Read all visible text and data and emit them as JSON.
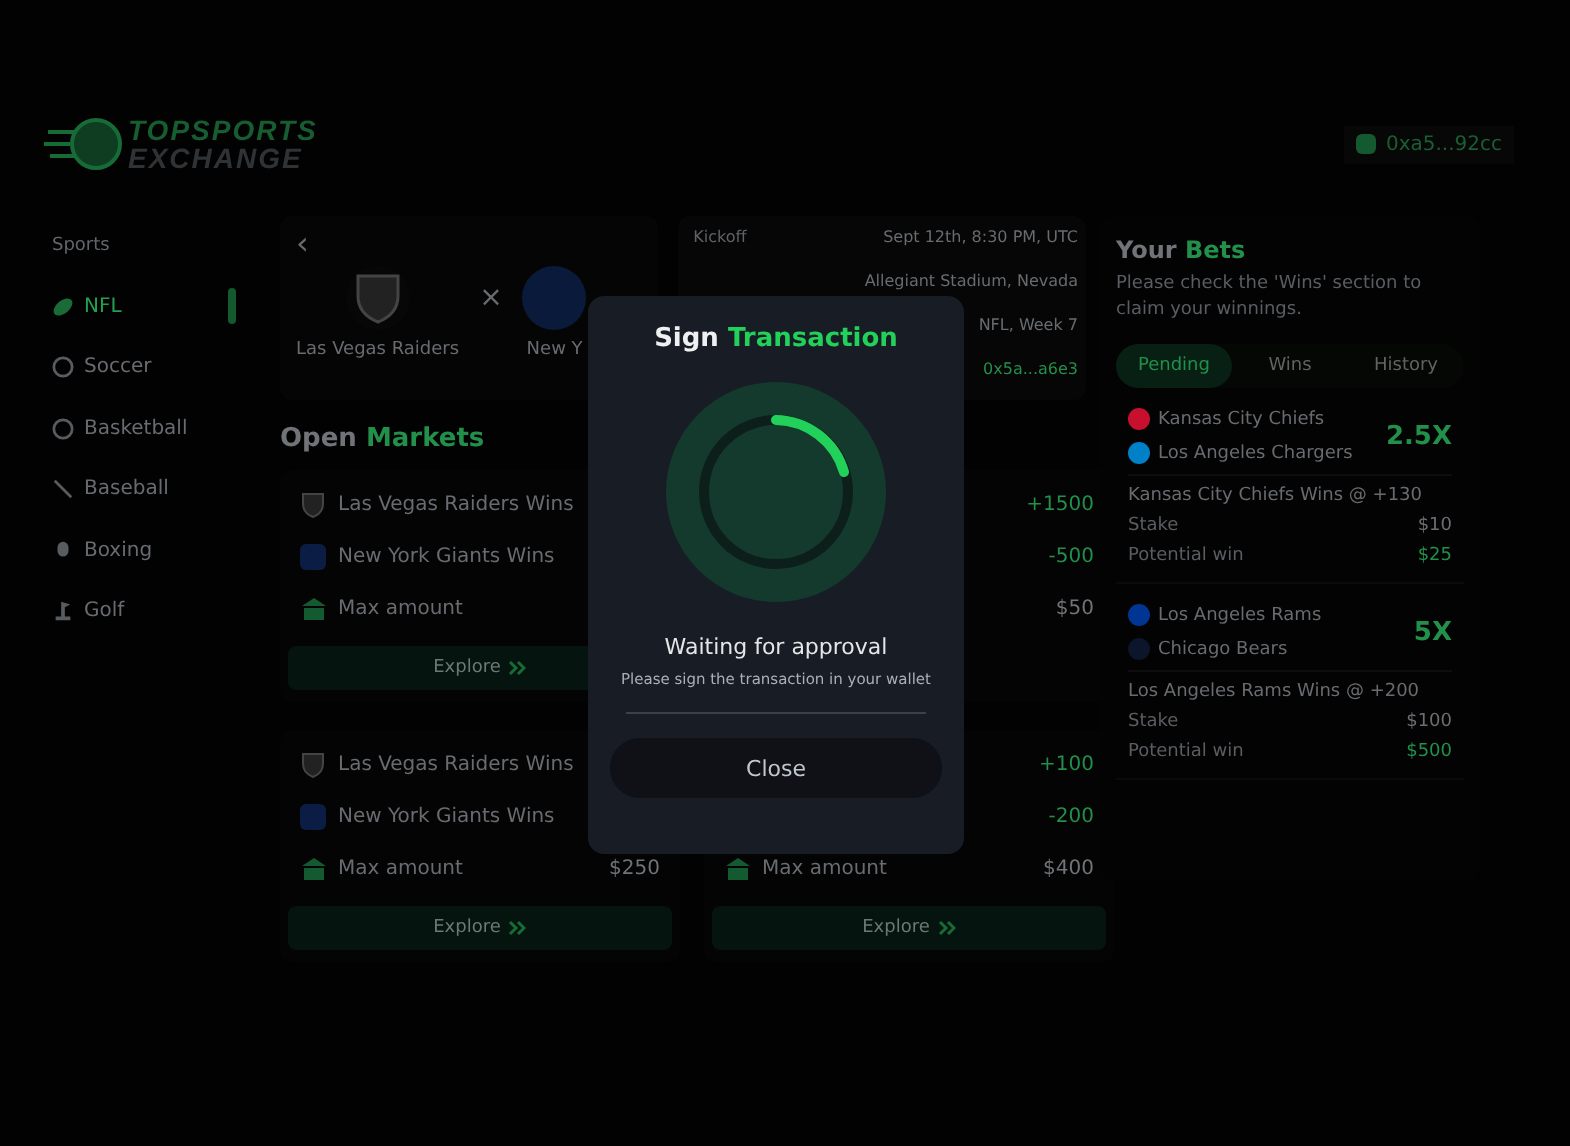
{
  "brand": {
    "line1": "TOPSPORTS",
    "line2": "EXCHANGE"
  },
  "wallet": {
    "address": "0xa5...92cc"
  },
  "sidebar": {
    "heading": "Sports",
    "items": [
      {
        "label": "NFL",
        "kind": "football",
        "selected": true
      },
      {
        "label": "Soccer",
        "kind": "soccer",
        "selected": false
      },
      {
        "label": "Basketball",
        "kind": "basketball",
        "selected": false
      },
      {
        "label": "Baseball",
        "kind": "baseball",
        "selected": false
      },
      {
        "label": "Boxing",
        "kind": "boxing",
        "selected": false
      },
      {
        "label": "Golf",
        "kind": "golf",
        "selected": false
      }
    ]
  },
  "match": {
    "back": "‹",
    "versus": "×",
    "teams": [
      {
        "name": "Las Vegas Raiders",
        "kind": "raiders"
      },
      {
        "name": "New Y",
        "kind": "giants"
      }
    ]
  },
  "details": {
    "rows": [
      {
        "label": "Kickoff",
        "value": "Sept 12th, 8:30 PM, UTC",
        "kind": "text"
      },
      {
        "value": "Allegiant Stadium, Nevada",
        "kind": "text"
      },
      {
        "value": "NFL, Week 7",
        "kind": "text"
      },
      {
        "value": "0x5a...a6e3",
        "kind": "link"
      }
    ]
  },
  "markets": {
    "title": "Open",
    "title_accent": "Markets",
    "cards": [
      {
        "rows": [
          {
            "kind": "raiders",
            "label": "Las Vegas Raiders Wins"
          },
          {
            "kind": "giants",
            "label": "New York Giants Wins"
          },
          {
            "kind": "amount",
            "label": "Max amount"
          }
        ],
        "explore": "Explore"
      },
      {
        "rows": [
          {
            "kind": "odds",
            "value": "+1500"
          },
          {
            "kind": "odds",
            "value": "-500"
          },
          {
            "kind": "amount",
            "value": "$50"
          }
        ]
      },
      {
        "rows": [
          {
            "kind": "raiders",
            "label": "Las Vegas Raiders Wins"
          },
          {
            "kind": "giants",
            "label": "New York Giants Wins"
          },
          {
            "kind": "amount",
            "label": "Max amount",
            "value": "$250"
          }
        ],
        "explore": "Explore"
      },
      {
        "rows": [
          {
            "kind": "odds",
            "value": "+100"
          },
          {
            "kind": "odds",
            "value": "-200"
          },
          {
            "kind": "amount",
            "label": "Max amount",
            "value": "$400"
          }
        ],
        "explore": "Explore"
      }
    ]
  },
  "bets": {
    "title": "Your",
    "title_accent": "Bets",
    "description": "Please check the 'Wins' section to claim your winnings.",
    "tabs": [
      {
        "label": "Pending",
        "selected": true
      },
      {
        "label": "Wins",
        "selected": false
      },
      {
        "label": "History",
        "selected": false
      }
    ],
    "slips": [
      {
        "teams": [
          {
            "name": "Kansas City Chiefs",
            "color": "#c8102e"
          },
          {
            "name": "Los Angeles Chargers",
            "color": "#0080c6"
          }
        ],
        "multiplier": "2.5X",
        "pick": "Kansas City Chiefs Wins @ +130",
        "stake_label": "Stake",
        "stake": "$10",
        "win_label": "Potential win",
        "win": "$25"
      },
      {
        "teams": [
          {
            "name": "Los Angeles Rams",
            "color": "#003594"
          },
          {
            "name": "Chicago Bears",
            "color": "#0b162a"
          }
        ],
        "multiplier": "5X",
        "pick": "Los Angeles Rams Wins @ +200",
        "stake_label": "Stake",
        "stake": "$100",
        "win_label": "Potential win",
        "win": "$500"
      }
    ]
  },
  "modal": {
    "title": "Sign",
    "title_accent": "Transaction",
    "status": "Waiting for approval",
    "message": "Please sign the transaction in your wallet",
    "button": "Close"
  }
}
